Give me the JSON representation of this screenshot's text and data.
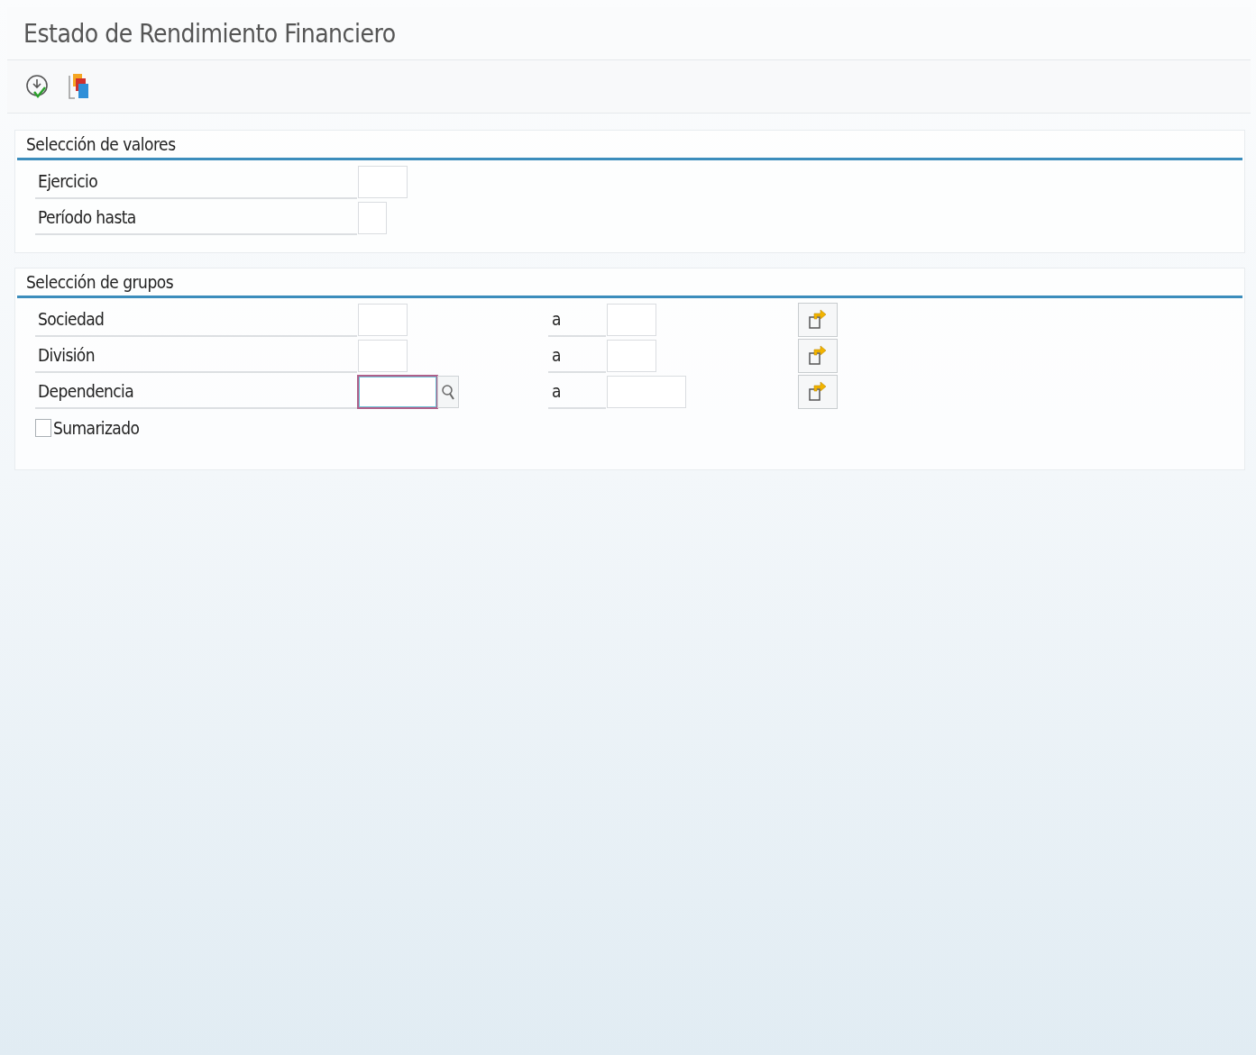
{
  "window": {
    "title": "Estado de Rendimiento Financiero"
  },
  "sections": [
    {
      "title": "Selección de valores",
      "fields": [
        {
          "kind": "single",
          "label": "Ejercicio",
          "focused": false
        },
        {
          "kind": "single",
          "label": "Período hasta",
          "focused": false
        }
      ]
    },
    {
      "title": "Selección de grupos",
      "fields": [
        {
          "kind": "range",
          "label": "Sociedad",
          "to_label": "a",
          "focused": false
        },
        {
          "kind": "range",
          "label": "División",
          "to_label": "a",
          "focused": false
        },
        {
          "kind": "range",
          "label": "Dependencia",
          "to_label": "a",
          "focused": true
        },
        {
          "kind": "checkbox",
          "label": "Sumarizado",
          "checked": false
        }
      ]
    }
  ]
}
